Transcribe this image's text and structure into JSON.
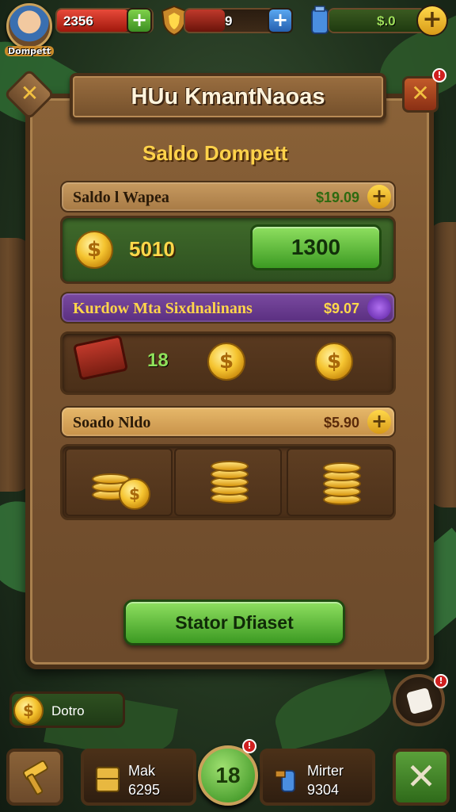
{
  "hud": {
    "avatar_name": "Dompett",
    "health_value": "2356",
    "shield_value": "9",
    "gold_value": "$.0",
    "plus": "+"
  },
  "panel": {
    "banner_title": "HUu KmantNaoas",
    "close_label": "✕",
    "back_label": "✕",
    "badge": "!",
    "section_title": "Saldo Dompett",
    "row1": {
      "label": "Saldo l Wapea",
      "value": "$19.09",
      "coin_amount": "5010",
      "claim_value": "1300"
    },
    "row2": {
      "label": "Kurdow Mta Sixdnalinans",
      "value": "$9.07",
      "chest_count": "18"
    },
    "row3": {
      "label": "Soado Nldo",
      "value": "$5.90"
    },
    "main_button": "Stator Dfiaset"
  },
  "bottom": {
    "wallet_label": "Dotro",
    "left_label": "Mak",
    "left_value": "6295",
    "center_value": "18",
    "right_label": "Mirter",
    "right_value": "9304",
    "center_badge": "!"
  },
  "icons": {
    "coin": "$"
  },
  "colors": {
    "accent_gold": "#ffd24a",
    "accent_green": "#3c9a22",
    "panel_wood": "#7a5430"
  }
}
